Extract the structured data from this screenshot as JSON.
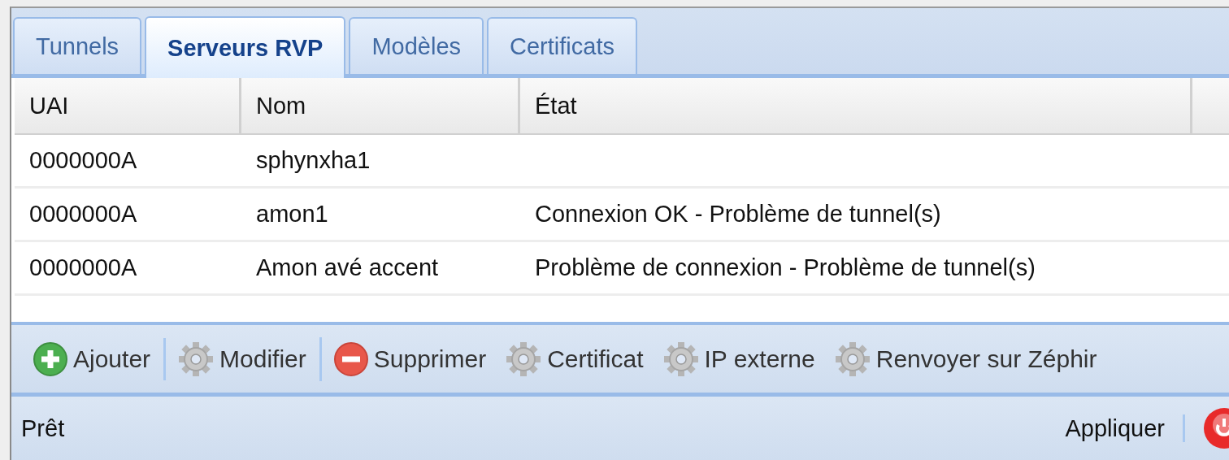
{
  "tabs": [
    {
      "label": "Tunnels",
      "selected": false
    },
    {
      "label": "Serveurs RVP",
      "selected": true
    },
    {
      "label": "Modèles",
      "selected": false
    },
    {
      "label": "Certificats",
      "selected": false
    }
  ],
  "table": {
    "columns": [
      "UAI",
      "Nom",
      "État"
    ],
    "rows": [
      [
        "0000000A",
        "sphynxha1",
        ""
      ],
      [
        "0000000A",
        "amon1",
        "Connexion OK - Problème de tunnel(s)"
      ],
      [
        "0000000A",
        "Amon avé accent",
        "Problème de connexion - Problème de tunnel(s)"
      ]
    ]
  },
  "toolbar": [
    {
      "kind": "add",
      "label": "Ajouter",
      "separated": true
    },
    {
      "kind": "gear",
      "label": "Modifier",
      "separated": true
    },
    {
      "kind": "remove",
      "label": "Supprimer",
      "separated": false
    },
    {
      "kind": "gear",
      "label": "Certificat",
      "separated": false
    },
    {
      "kind": "gear",
      "label": "IP externe",
      "separated": false
    },
    {
      "kind": "gear",
      "label": "Renvoyer sur Zéphir",
      "separated": false
    }
  ],
  "status_bar": {
    "text": "Prêt",
    "action": "Appliquer"
  }
}
